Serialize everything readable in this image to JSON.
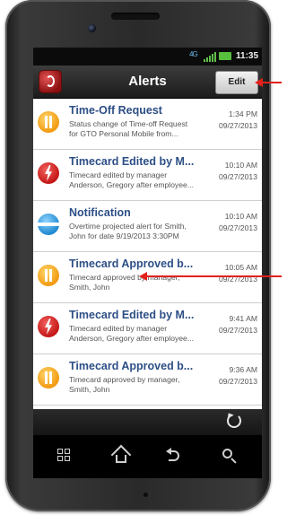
{
  "status_bar": {
    "network_label": "4G",
    "time": "11:35"
  },
  "header": {
    "title": "Alerts",
    "edit_label": "Edit"
  },
  "alerts": [
    {
      "icon": "pause-icon",
      "title": "Time-Off Request",
      "desc1": "Status change of Time-off Request",
      "desc2": "for GTO Personal Mobile from...",
      "time": "1:34 PM",
      "date": "09/27/2013"
    },
    {
      "icon": "lightning-icon",
      "title": "Timecard Edited by M...",
      "desc1": "Timecard edited by manager",
      "desc2": "Anderson, Gregory after employee...",
      "time": "10:10 AM",
      "date": "09/27/2013"
    },
    {
      "icon": "minus-icon",
      "title": "Notification",
      "desc1": "Overtime projected alert for Smith,",
      "desc2": "John for date 9/19/2013 3:30PM",
      "time": "10:10 AM",
      "date": "09/27/2013"
    },
    {
      "icon": "pause-icon",
      "title": "Timecard Approved b...",
      "desc1": "Timecard approved by manager,",
      "desc2": "Smith, John",
      "time": "10:05 AM",
      "date": "09/27/2013"
    },
    {
      "icon": "lightning-icon",
      "title": "Timecard Edited by M...",
      "desc1": "Timecard edited by manager",
      "desc2": "Anderson, Gregory after employee...",
      "time": "9:41 AM",
      "date": "09/27/2013"
    },
    {
      "icon": "pause-icon",
      "title": "Timecard Approved b...",
      "desc1": "Timecard approved by manager,",
      "desc2": "Smith, John",
      "time": "9:36 AM",
      "date": "09/27/2013"
    }
  ],
  "colors": {
    "accent_title": "#2d4f86",
    "annotation_arrow": "#e3211c",
    "battery": "#57c03e"
  }
}
